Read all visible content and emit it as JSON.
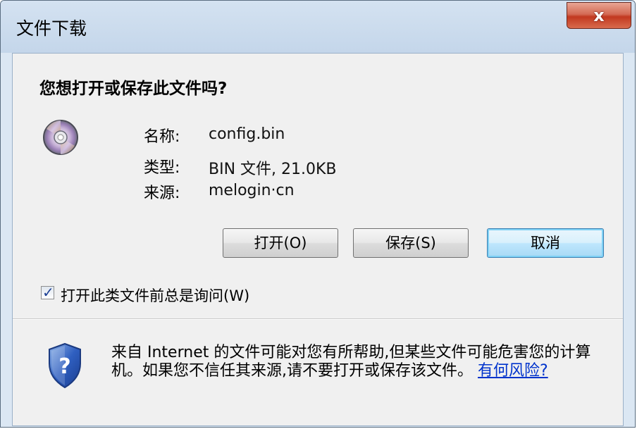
{
  "window": {
    "title": "文件下载",
    "close_label": "x"
  },
  "dialog": {
    "question": "您想打开或保存此文件吗?",
    "file": {
      "name_label": "名称:",
      "name_value": "config.bin",
      "type_label": "类型:",
      "type_value": "BIN 文件, 21.0KB",
      "source_label": "来源:",
      "source_value": "melogin·cn"
    },
    "buttons": {
      "open": "打开(O)",
      "save": "保存(S)",
      "cancel": "取消"
    },
    "checkbox": {
      "label": "打开此类文件前总是询问(W)",
      "checked": true
    },
    "warning": {
      "text": "来自 Internet 的文件可能对您有所帮助,但某些文件可能危害您的计算机。如果您不信任其来源,请不要打开或保存该文件。",
      "link": "有何风险?"
    }
  },
  "icons": {
    "file_icon": "disc-icon",
    "security_icon": "shield-question-icon"
  }
}
